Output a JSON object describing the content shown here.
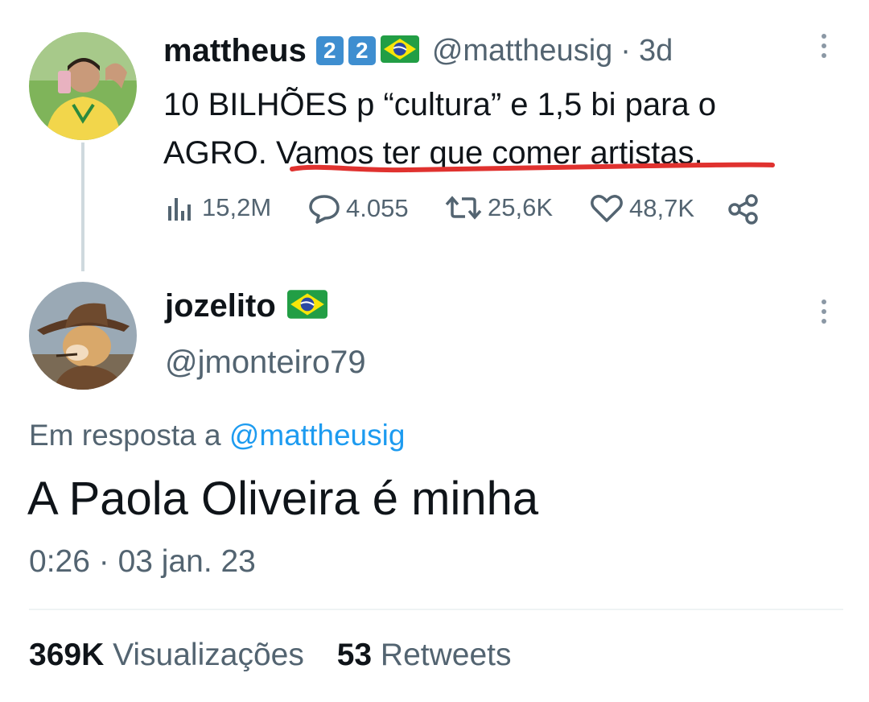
{
  "tweet": {
    "author_name": "mattheus",
    "badges": [
      "2",
      "2"
    ],
    "flag": "brazil-flag-icon",
    "handle": "@mattheusig",
    "separator": "·",
    "age": "3d",
    "text_line1": "10 BILHÕES p “cultura” e 1,5 bi para o",
    "text_line2_a": "AGRO. ",
    "text_line2_b": "Vamos ter que comer artistas.",
    "metrics": {
      "views": "15,2M",
      "replies": "4.055",
      "retweets": "25,6K",
      "likes": "48,7K"
    }
  },
  "reply": {
    "author_name": "jozelito",
    "flag": "brazil-flag-icon",
    "handle": "@jmonteiro79",
    "in_reply_prefix": "Em resposta a ",
    "in_reply_handle": "@mattheusig",
    "text": "A Paola Oliveira é minha",
    "timestamp": "0:26 · 03 jan. 23"
  },
  "stats": {
    "views_count": "369K",
    "views_label": "Visualizações",
    "retweets_count": "53",
    "retweets_label": "Retweets"
  },
  "colors": {
    "link": "#1d9bf0",
    "muted": "#536471",
    "underline": "#e0322f",
    "badge": "#3e8ed0"
  }
}
